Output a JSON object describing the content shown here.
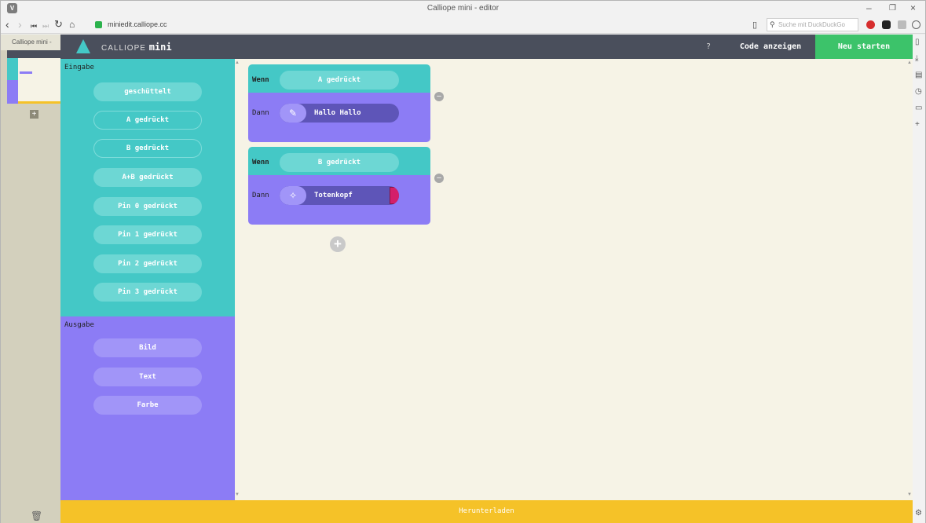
{
  "browser": {
    "window_title": "Calliope mini - editor",
    "url": "miniedit.calliope.cc",
    "search_placeholder": "Suche mit DuckDuckGo",
    "tab_title": "Calliope mini -",
    "controls": {
      "minimize": "–",
      "restore": "❐",
      "close": "×"
    }
  },
  "app": {
    "logo_text": "CALLIOPE",
    "logo_mini": "mini",
    "help_label": "?",
    "code_label": "Code anzeigen",
    "restart_label": "Neu starten",
    "download_label": "Herunterladen"
  },
  "palette": {
    "input_section": "Eingabe",
    "input_items": [
      "geschüttelt",
      "A gedrückt",
      "B gedrückt",
      "A+B gedrückt",
      "Pin 0 gedrückt",
      "Pin 1 gedrückt",
      "Pin 2 gedrückt",
      "Pin 3 gedrückt"
    ],
    "output_section": "Ausgabe",
    "output_items": [
      "Bild",
      "Text",
      "Farbe"
    ]
  },
  "rules": [
    {
      "when_label": "Wenn",
      "condition": "A gedrückt",
      "then_label": "Dann",
      "action_icon": "pencil-icon",
      "action": "Hallo Hallo"
    },
    {
      "when_label": "Wenn",
      "condition": "B gedrückt",
      "then_label": "Dann",
      "action_icon": "sparkle-icon",
      "action": "Totenkopf"
    }
  ],
  "colors": {
    "header": "#4a4f5c",
    "input": "#44c8c6",
    "output": "#8c7cf5",
    "canvas": "#f6f3e6",
    "restart": "#3cc36a",
    "download": "#f5c228",
    "skull": "#d31f6a"
  }
}
